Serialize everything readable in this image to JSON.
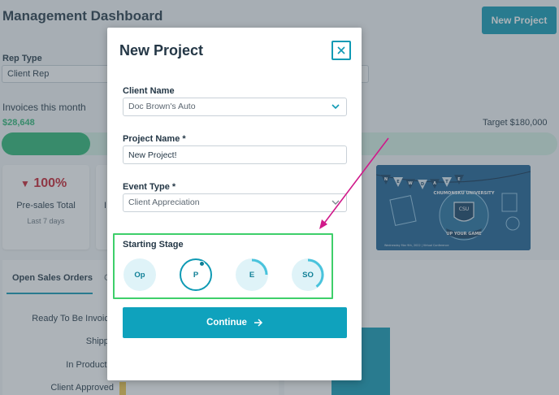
{
  "dashboard": {
    "title": "Management Dashboard",
    "new_project_label": "New Project",
    "rep_type_label": "Rep Type",
    "rep_type_value": "Client Rep",
    "invoices_label": "Invoices this month",
    "invoices_amount": "$28,648",
    "target_label": "Target $180,000",
    "invoice_progress_fraction": 0.16,
    "stat_card": {
      "percent": "100%",
      "label": "Pre-sales Total",
      "sub": "Last 7 days"
    },
    "stat_card2_partial": "I",
    "orders_tabs": [
      "Open Sales Orders",
      "C"
    ],
    "order_rows": [
      "Ready To Be Invoice",
      "Shippe",
      "In Productio",
      "Client Approved"
    ],
    "banner": {
      "bunting": [
        "N",
        "E",
        "W",
        "D",
        "A",
        "T",
        "E"
      ],
      "university": "CHUMONSKU UNIVERSITY",
      "slogan": "UP YOUR GAME",
      "shield_top": "CSU",
      "date_line": "Wednesday Mar 9th, 2022 | Virtual Conference"
    }
  },
  "modal": {
    "title": "New Project",
    "client_name_label": "Client Name",
    "client_name_value": "Doc Brown's Auto",
    "project_name_label": "Project Name *",
    "project_name_value": "New Project!",
    "event_type_label": "Event Type *",
    "event_type_value": "Client Appreciation",
    "starting_stage_label": "Starting Stage",
    "stages": [
      {
        "code": "Op",
        "active": false,
        "progress": 0
      },
      {
        "code": "P",
        "active": true,
        "progress": 0
      },
      {
        "code": "E",
        "active": false,
        "progress": 0.25
      },
      {
        "code": "SO",
        "active": false,
        "progress": 0.4
      }
    ],
    "continue_label": "Continue"
  },
  "colors": {
    "accent": "#0f9ab4",
    "green": "#2bb673",
    "red": "#c8202f",
    "highlight_box": "#3ecf6a",
    "annotation_arrow": "#d0198a"
  }
}
